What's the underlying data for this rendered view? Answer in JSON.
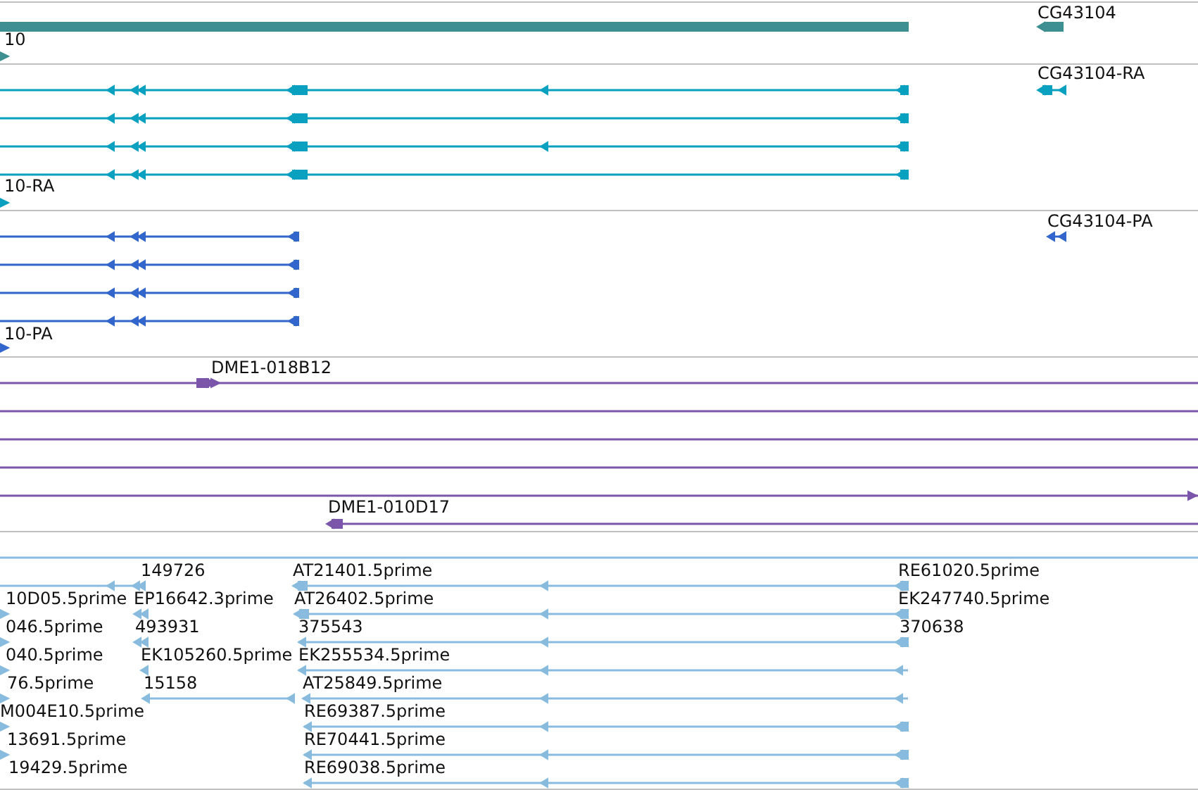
{
  "tracks": [
    {
      "kind": "gene",
      "color": "#3d8f91",
      "labels": [
        "10",
        "CG43104"
      ]
    },
    {
      "kind": "transcript",
      "color": "#0aa0c0",
      "labels": [
        "10-RA",
        "CG43104-RA"
      ]
    },
    {
      "kind": "protein",
      "color": "#3366cc",
      "labels": [
        "10-PA",
        "CG43104-PA"
      ]
    },
    {
      "kind": "clone",
      "color": "#7a55aa",
      "labels": [
        "DME1-018B12",
        "DME1-010D17"
      ]
    },
    {
      "kind": "est",
      "color": "#88bbdd",
      "labels": [
        "149726",
        "AT21401.5prime",
        "RE61020.5prime",
        "10D05.5prime",
        "EP16642.3prime",
        "AT26402.5prime",
        "EK247740.5prime",
        "046.5prime",
        "493931",
        "375543",
        "370638",
        "040.5prime",
        "EK105260.5prime",
        "EK255534.5prime",
        "76.5prime",
        "15158",
        "AT25849.5prime",
        "M004E10.5prime",
        "RE69387.5prime",
        "13691.5prime",
        "RE70441.5prime",
        "19429.5prime",
        "RE69038.5prime"
      ]
    }
  ]
}
